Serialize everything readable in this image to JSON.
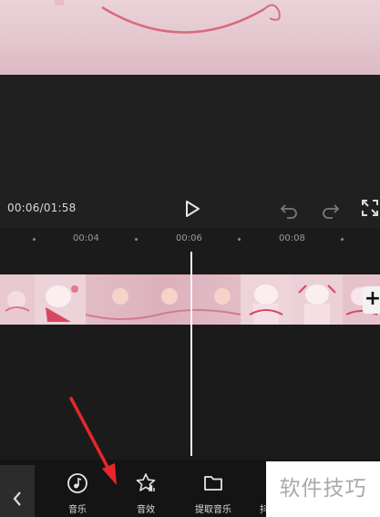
{
  "player": {
    "time_readout": "00:06/01:58",
    "icons": {
      "play": "play-icon",
      "undo": "undo-icon",
      "redo": "redo-icon",
      "fullscreen": "fullscreen-icon"
    }
  },
  "timeline": {
    "tick_labels": [
      "00:04",
      "00:06",
      "00:08"
    ],
    "add_clip_label": "+"
  },
  "toolbar": {
    "back_icon": "chevron-left-icon",
    "tools": [
      {
        "label": "音乐",
        "icon": "music-note-icon"
      },
      {
        "label": "音效",
        "icon": "star-sound-icon"
      },
      {
        "label": "提取音乐",
        "icon": "folder-icon"
      },
      {
        "label": "抖",
        "icon": "douyin-icon"
      }
    ]
  },
  "watermark": {
    "text": "软件技巧"
  },
  "colors": {
    "background": "#1a1a1a",
    "toolbar": "#141414",
    "accent_arrow": "#e8262c",
    "playhead": "#f4f4f4"
  }
}
